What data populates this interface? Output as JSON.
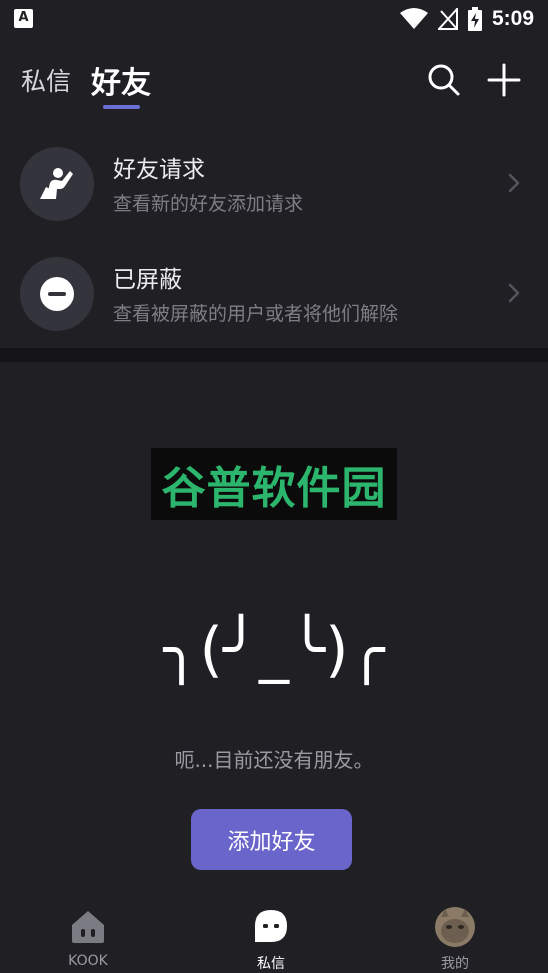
{
  "status_bar": {
    "app_icon_letter": "A",
    "time": "5:09"
  },
  "header": {
    "tab_dm": "私信",
    "tab_friends": "好友",
    "accent_color": "#6b6fd4"
  },
  "rows": [
    {
      "title": "好友请求",
      "subtitle": "查看新的好友添加请求",
      "icon": "raised-hand-person-icon"
    },
    {
      "title": "已屏蔽",
      "subtitle": "查看被屏蔽的用户或者将他们解除",
      "icon": "block-icon"
    }
  ],
  "watermark": {
    "text": "谷普软件园",
    "color": "#2cb56d"
  },
  "empty_state": {
    "kaomoji": "╮(╯_╰)╭",
    "message": "呃...目前还没有朋友。",
    "button_label": "添加好友",
    "button_color": "#6a65cb"
  },
  "bottom_nav": {
    "items": [
      {
        "label": "KOOK",
        "icon": "home-kook-icon"
      },
      {
        "label": "私信",
        "icon": "chat-bubble-icon"
      },
      {
        "label": "我的",
        "icon": "avatar"
      }
    ]
  }
}
